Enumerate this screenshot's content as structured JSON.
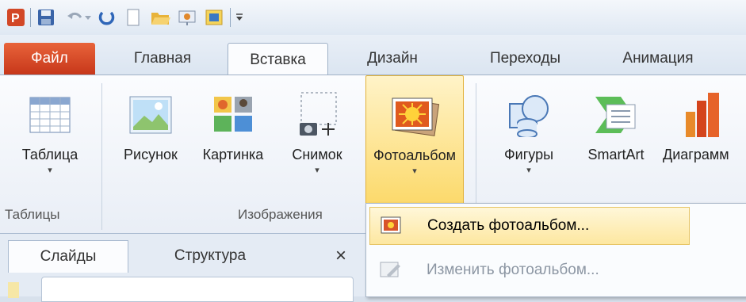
{
  "qat": {
    "icons": [
      "powerpoint-logo-icon",
      "save-icon",
      "undo-icon",
      "undo-dropdown-icon",
      "redo-icon",
      "new-icon",
      "open-icon",
      "slideshow-icon",
      "picture-icon",
      "customize-qat-icon"
    ]
  },
  "tabs": [
    {
      "label": "Файл"
    },
    {
      "label": "Главная"
    },
    {
      "label": "Вставка"
    },
    {
      "label": "Дизайн"
    },
    {
      "label": "Переходы"
    },
    {
      "label": "Анимация"
    }
  ],
  "ribbon": {
    "table": {
      "label": "Таблица",
      "arrow": "▾"
    },
    "picture": {
      "label": "Рисунок"
    },
    "clipart": {
      "label": "Картинка"
    },
    "screenshot": {
      "label": "Снимок",
      "arrow": "▾"
    },
    "photoalbum": {
      "label": "Фотоальбом",
      "arrow": "▾"
    },
    "shapes": {
      "label": "Фигуры",
      "arrow": "▾"
    },
    "smartart": {
      "label": "SmartArt"
    },
    "chart": {
      "label": "Диаграмм"
    },
    "groups": {
      "tables": "Таблицы",
      "images": "Изображения"
    }
  },
  "pane": {
    "tab_slides": "Слайды",
    "tab_outline": "Структура",
    "close": "×"
  },
  "menu": {
    "create": "Создать фотоальбом...",
    "edit": "Изменить фотоальбом..."
  },
  "colors": {
    "file_tab": "#d64a27",
    "highlight": "#fcd96a",
    "accent": "#2b579a"
  }
}
